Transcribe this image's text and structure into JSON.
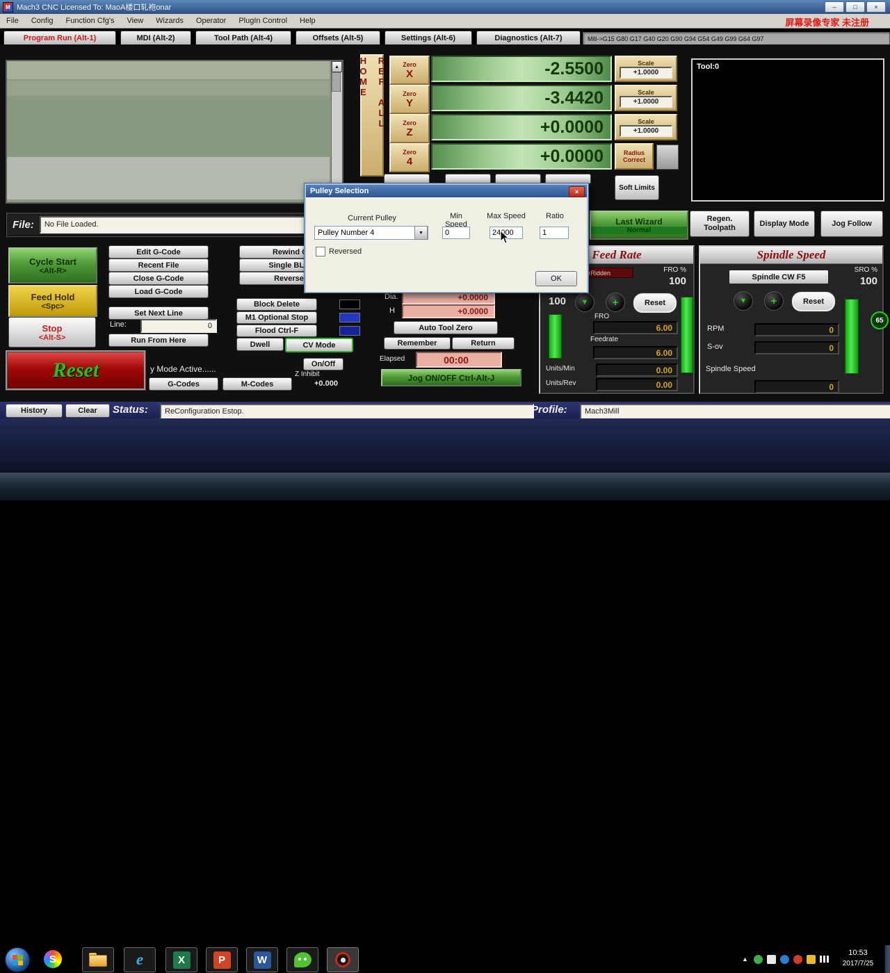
{
  "icons": {
    "minimize": "–",
    "maximize": "□",
    "close": "×",
    "dropdown": "▼",
    "scroll_up": "▲",
    "tray_expand": "▲",
    "down_circle": "▼",
    "plus_circle": "+"
  },
  "titlebar": {
    "title": "Mach3 CNC  Licensed To: MaoA楼口轧袍onar"
  },
  "menubar": {
    "items": [
      "File",
      "Config",
      "Function Cfg's",
      "View",
      "Wizards",
      "Operator",
      "PlugIn Control",
      "Help"
    ],
    "watermark": "屏幕录像专家 未注册"
  },
  "tabs": {
    "items": [
      "Program Run (Alt-1)",
      "MDI (Alt-2)",
      "Tool Path (Alt-4)",
      "Offsets (Alt-5)",
      "Settings (Alt-6)",
      "Diagnostics (Alt-7)"
    ],
    "modal_line": "Mill->G15 G80 G17 G40 G20 G90 G94 G54 G49 G99 G64 G97"
  },
  "dro": {
    "ref_all_home": "REF ALL HOME",
    "zero_label": "Zero",
    "axis_letters": [
      "X",
      "Y",
      "Z",
      "4"
    ],
    "values": [
      "-2.5500",
      "-3.4420",
      "+0.0000",
      "+0.0000"
    ],
    "scale_label": "Scale",
    "scale_values": [
      "+1.0000",
      "+1.0000",
      "+1.0000"
    ],
    "radius_correct": "Radius Correct",
    "soft_limits": "Soft Limits"
  },
  "toolpath": {
    "tool": "Tool:0"
  },
  "wizard": {
    "last_wizard": "Last Wizard",
    "last_wizard_sub": "Normal",
    "regen": "Regen. Toolpath",
    "display_mode": "Display Mode",
    "jog_follow": "Jog Follow"
  },
  "file": {
    "label": "File:",
    "value": "No File Loaded."
  },
  "run": {
    "cycle_start": "Cycle Start",
    "cycle_start_key": "<Alt-R>",
    "feed_hold": "Feed Hold",
    "feed_hold_key": "<Spc>",
    "stop": "Stop",
    "stop_key": "<Alt-S>",
    "reset": "Reset"
  },
  "gcode_buttons": {
    "edit": "Edit G-Code",
    "recent": "Recent File",
    "close": "Close G-Code",
    "load": "Load G-Code",
    "set_next": "Set Next Line",
    "line_label": "Line:",
    "line_value": "0",
    "run_from_here": "Run From Here",
    "rewind": "Rewind Ctr",
    "single_blk": "Single BLK A",
    "reverse": "Reverse R",
    "block_delete": "Block Delete",
    "m1": "M1 Optional Stop",
    "flood": "Flood Ctrl-F",
    "dwell": "Dwell",
    "cv_mode": "CV Mode",
    "mode_text": "y Mode Active......",
    "gcodes": "G-Codes",
    "mcodes": "M-Codes",
    "onoff": "On/Off",
    "z_inhibit": "Z Inhibit",
    "z_value": "+0.000"
  },
  "tool": {
    "dia_label": "Dia.",
    "dia_value": "+0.0000",
    "h_label": "H",
    "h_value": "+0.0000",
    "auto_zero": "Auto Tool Zero",
    "remember": "Remember",
    "return": "Return",
    "elapsed_label": "Elapsed",
    "elapsed_value": "00:00",
    "jog_onoff": "Jog ON/OFF Ctrl-Alt-J"
  },
  "feed": {
    "title": "Feed Rate",
    "overridden": "OverRidden",
    "fro_pct": "FRO %",
    "fro_pct_value": "100",
    "slider_value": "100",
    "fro": "FRO",
    "fro_value": "6.00",
    "feedrate": "Feedrate",
    "feedrate_value": "6.00",
    "units_min": "Units/Min",
    "units_min_value": "0.00",
    "units_rev": "Units/Rev",
    "units_rev_value": "0.00",
    "reset": "Reset"
  },
  "spindle": {
    "title": "Spindle Speed",
    "cw": "Spindle CW F5",
    "sro": "SRO %",
    "sro_value": "100",
    "reset": "Reset",
    "rpm": "RPM",
    "rpm_value": "0",
    "sov": "S-ov",
    "sov_value": "0",
    "speed": "Spindle Speed",
    "speed_value": "0"
  },
  "dialog": {
    "title": "Pulley Selection",
    "current_pulley_label": "Current Pulley",
    "pulley_value": "Pulley Number 4",
    "min_speed_label": "Min Speed",
    "min_speed_value": "0",
    "max_speed_label": "Max Speed",
    "max_speed_value": "24000",
    "ratio_label": "Ratio",
    "ratio_value": "1",
    "reversed_label": "Reversed",
    "ok": "OK"
  },
  "status": {
    "history": "History",
    "clear": "Clear",
    "status_label": "Status:",
    "status_value": "ReConfiguration Estop.",
    "profile_label": "Profile:",
    "profile_value": "Mach3Mill"
  },
  "taskbar": {
    "time": "10:53",
    "date": "2017/7/25",
    "letters": {
      "browser": "S",
      "ie": "e",
      "excel": "X",
      "ppt": "P",
      "word": "W"
    }
  },
  "overlay_badge": "65",
  "colors": {
    "dro_green": "#9cc98e",
    "value_gold": "#d6a41e",
    "alert_red": "#c02020",
    "button_green": "#4f9a38",
    "watermark_red": "#e01818",
    "led_blue": "#2336c6"
  }
}
